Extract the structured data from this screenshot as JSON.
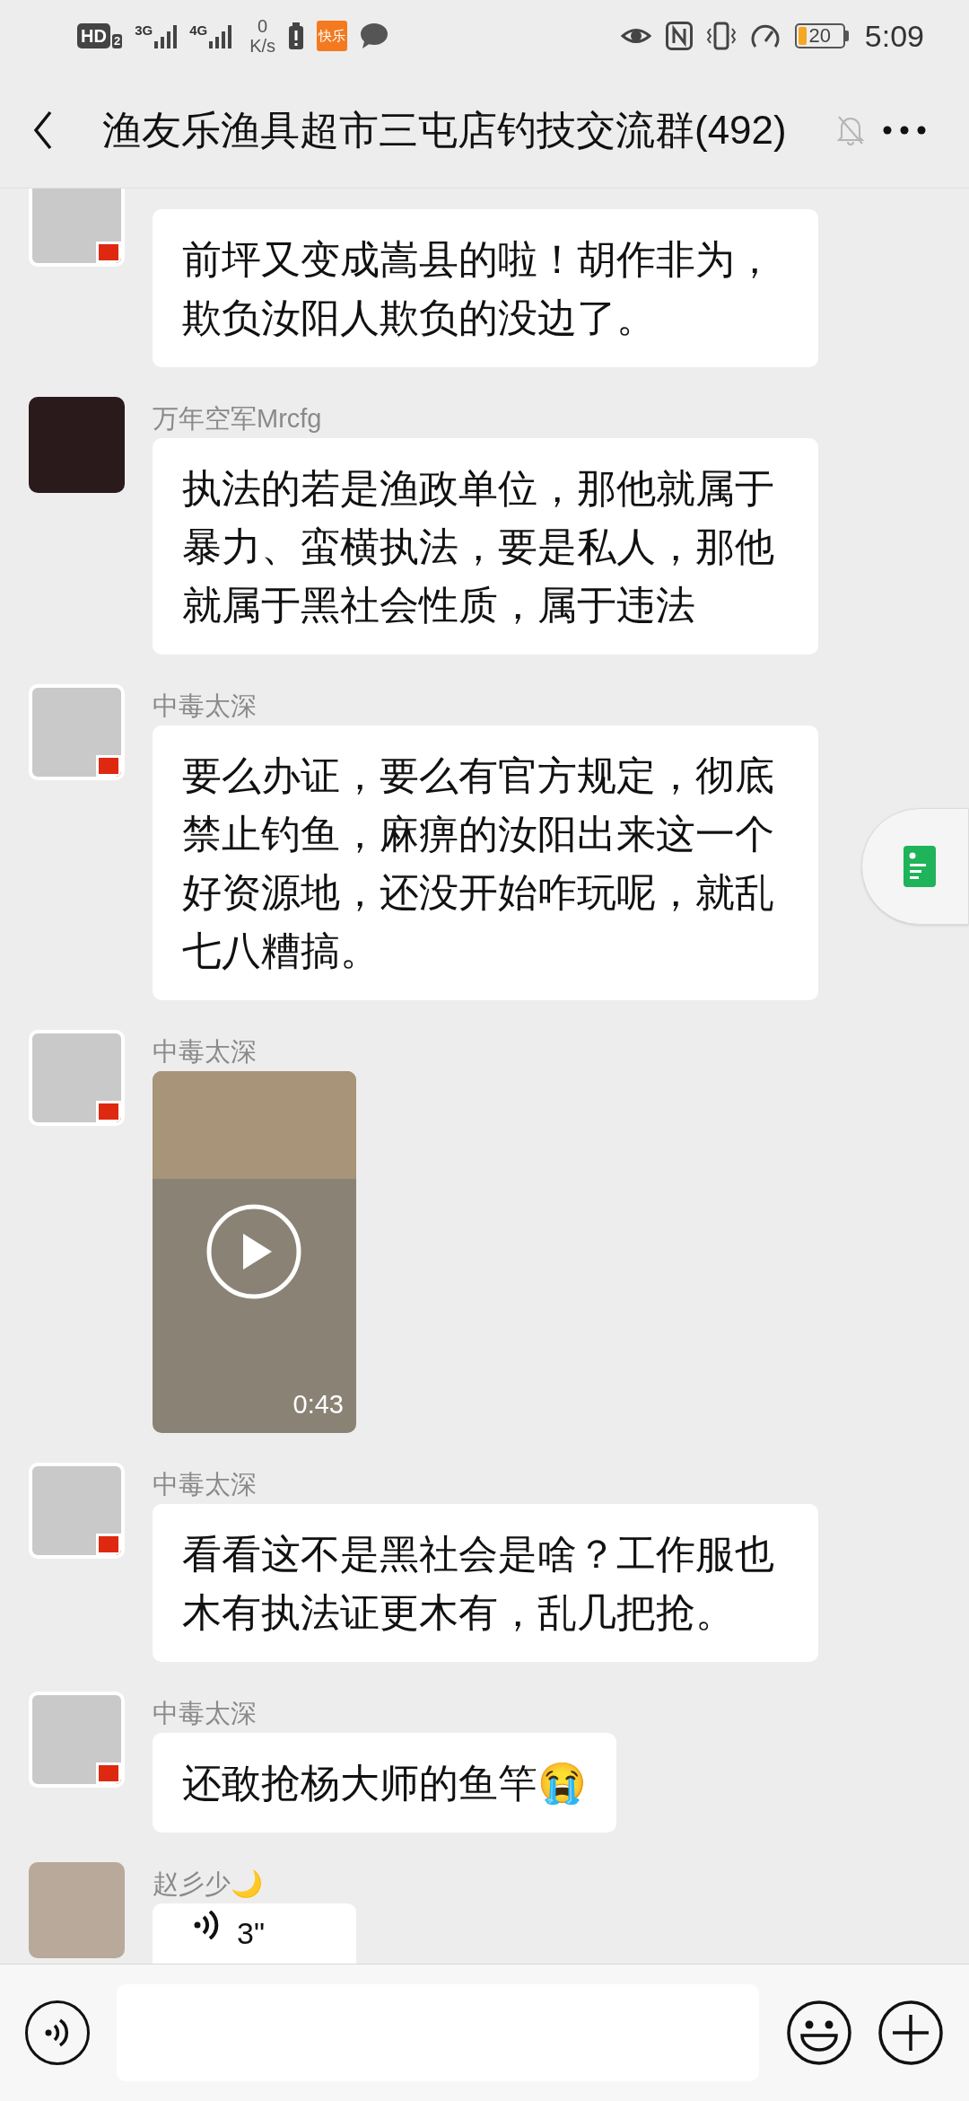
{
  "status_bar": {
    "hd": "HD",
    "hd_sub": "2",
    "network_1": "3G",
    "network_2": "4G",
    "speed_value": "0",
    "speed_unit": "K/s",
    "app_badge": "快乐",
    "battery": "20",
    "time": "5:09"
  },
  "header": {
    "title": "渔友乐渔具超市三屯店钓技交流群(492)",
    "muted": true
  },
  "messages": [
    {
      "kind": "text",
      "avatar": {
        "kind": "calligraphy"
      },
      "text": "前坪又变成嵩县的啦！胡作非为，欺负汝阳人欺负的没边了。"
    },
    {
      "kind": "text",
      "avatar": {
        "kind": "dark-photo"
      },
      "sender": "万年空军Mrcfg",
      "text": "执法的若是渔政单位，那他就属于暴力、蛮横执法，要是私人，那他就属于黑社会性质，属于违法"
    },
    {
      "kind": "text",
      "avatar": {
        "kind": "calligraphy"
      },
      "sender": "中毒太深",
      "text": "要么办证，要么有官方规定，彻底禁止钓鱼，麻痹的汝阳出来这一个好资源地，还没开始咋玩呢，就乱七八糟搞。"
    },
    {
      "kind": "video",
      "avatar": {
        "kind": "calligraphy"
      },
      "sender": "中毒太深",
      "duration": "0:43"
    },
    {
      "kind": "text",
      "avatar": {
        "kind": "calligraphy"
      },
      "sender": "中毒太深",
      "text": "看看这不是黑社会是啥？工作服也木有执法证更木有，乱几把抢。"
    },
    {
      "kind": "text",
      "avatar": {
        "kind": "calligraphy"
      },
      "sender": "中毒太深",
      "text": "还敢抢杨大师的鱼竿😭"
    },
    {
      "kind": "voice",
      "avatar": {
        "kind": "child-photo"
      },
      "sender": "赵彡少🌙",
      "duration": "3\""
    }
  ]
}
